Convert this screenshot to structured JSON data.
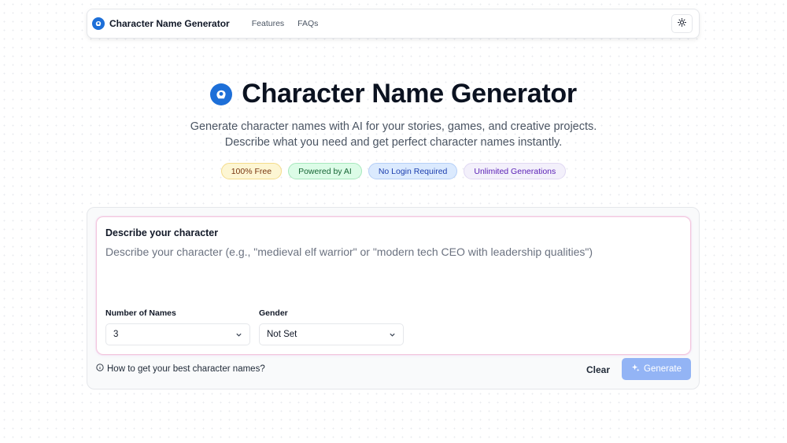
{
  "nav": {
    "logo_icon": "brain-badge-icon",
    "brand": "Character Name Generator",
    "links": [
      "Features",
      "FAQs"
    ],
    "theme_icon": "sun-icon"
  },
  "hero": {
    "title": "Character Name Generator",
    "subtitle_line1": "Generate character names with AI for your stories, games, and creative projects.",
    "subtitle_line2": "Describe what you need and get perfect character names instantly.",
    "badges": [
      "100% Free",
      "Powered by AI",
      "No Login Required",
      "Unlimited Generations"
    ]
  },
  "form": {
    "label": "Describe your character",
    "placeholder": "Describe your character (e.g., \"medieval elf warrior\" or \"modern tech CEO with leadership qualities\")",
    "count_label": "Number of Names",
    "count_value": "3",
    "gender_label": "Gender",
    "gender_value": "Not Set",
    "help_text": "How to get your best character names?",
    "clear_label": "Clear",
    "generate_label": "Generate"
  },
  "colors": {
    "brand_blue": "#1d6fd8",
    "generate_disabled": "#93b4f5"
  }
}
